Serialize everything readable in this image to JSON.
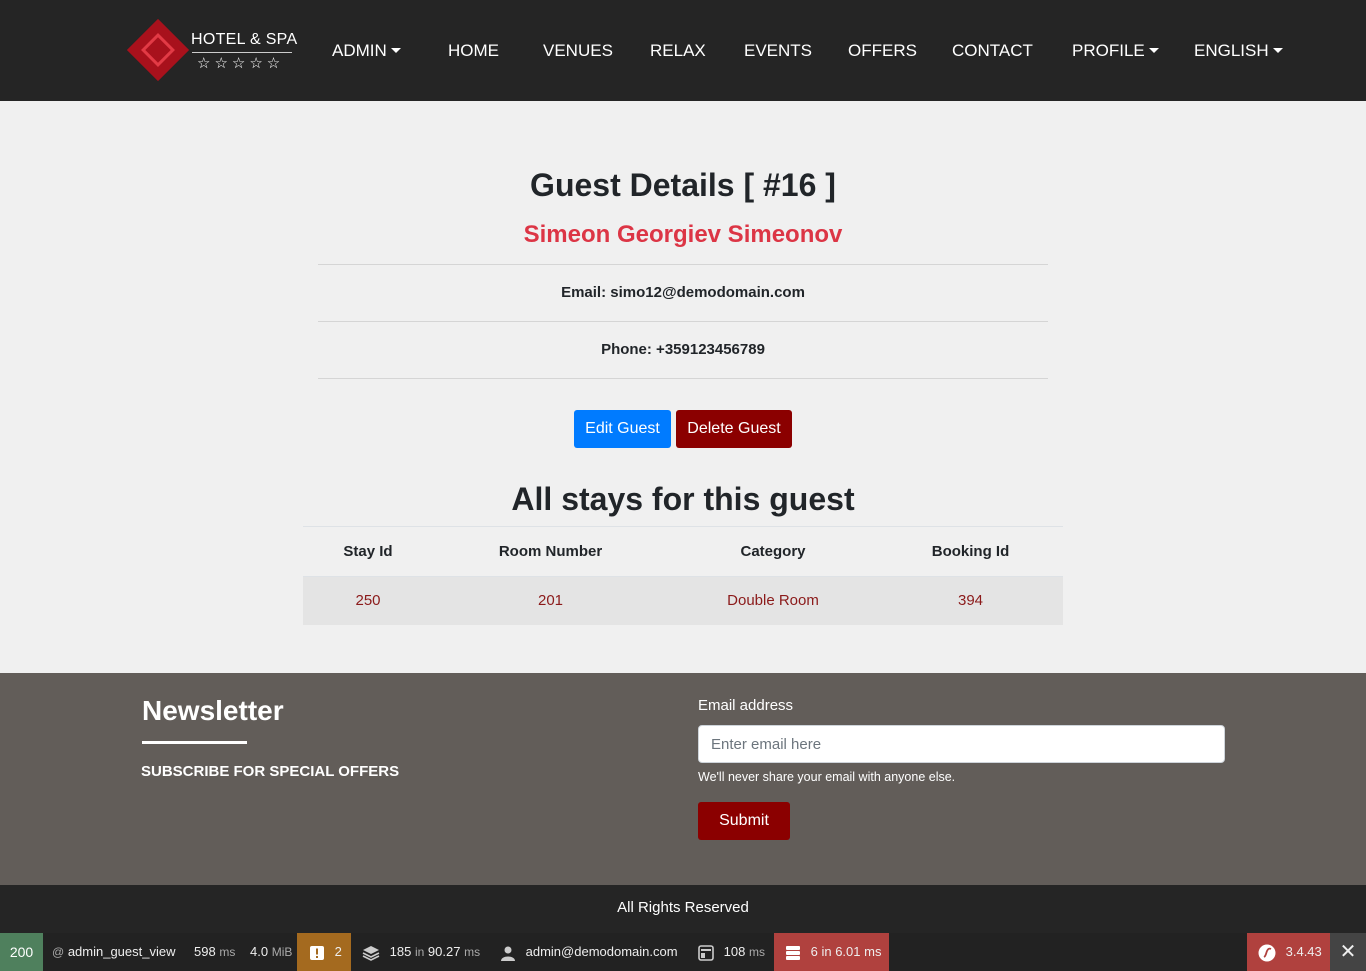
{
  "brand": {
    "name": "HOTEL & SPA",
    "stars": "☆☆☆☆☆"
  },
  "nav": {
    "admin": "ADMIN",
    "home": "HOME",
    "venues": "VENUES",
    "relax": "RELAX",
    "events": "EVENTS",
    "offers": "OFFERS",
    "contact": "CONTACT",
    "profile": "PROFILE",
    "language": "ENGLISH"
  },
  "guest": {
    "title": "Guest Details [ #16 ]",
    "name": "Simeon Georgiev Simeonov",
    "email_line": "Email: simo12@demodomain.com",
    "phone_line": "Phone: +359123456789"
  },
  "actions": {
    "edit": "Edit Guest",
    "delete": "Delete Guest"
  },
  "stays": {
    "title": "All stays for this guest",
    "columns": [
      "Stay Id",
      "Room Number",
      "Category",
      "Booking Id"
    ],
    "rows": [
      [
        "250",
        "201",
        "Double Room",
        "394"
      ]
    ]
  },
  "footer": {
    "newsletter_title": "Newsletter",
    "newsletter_sub": "SUBSCRIBE FOR SPECIAL OFFERS",
    "email_label": "Email address",
    "email_placeholder": "Enter email here",
    "email_help": "We'll never share your email with anyone else.",
    "submit": "Submit",
    "copyright": "All Rights Reserved"
  },
  "toolbar": {
    "status": "200",
    "route_at": "@",
    "route": "admin_guest_view",
    "time_value": "598",
    "time_unit": "ms",
    "memory_value": "4.0",
    "memory_unit": "MiB",
    "warnings": "2",
    "cache_count": "185",
    "cache_in": "in",
    "cache_time": "90.27",
    "cache_unit": "ms",
    "user": "admin@demodomain.com",
    "twig_time": "108",
    "twig_unit": "ms",
    "db": "6 in 6.01 ms",
    "version": "3.4.43",
    "close": "✕"
  },
  "colors": {
    "accent": "#dc3545",
    "dark_red": "#8b0000",
    "primary": "#007bff",
    "nav_bg": "#252525",
    "footer_bg": "#625d59"
  }
}
